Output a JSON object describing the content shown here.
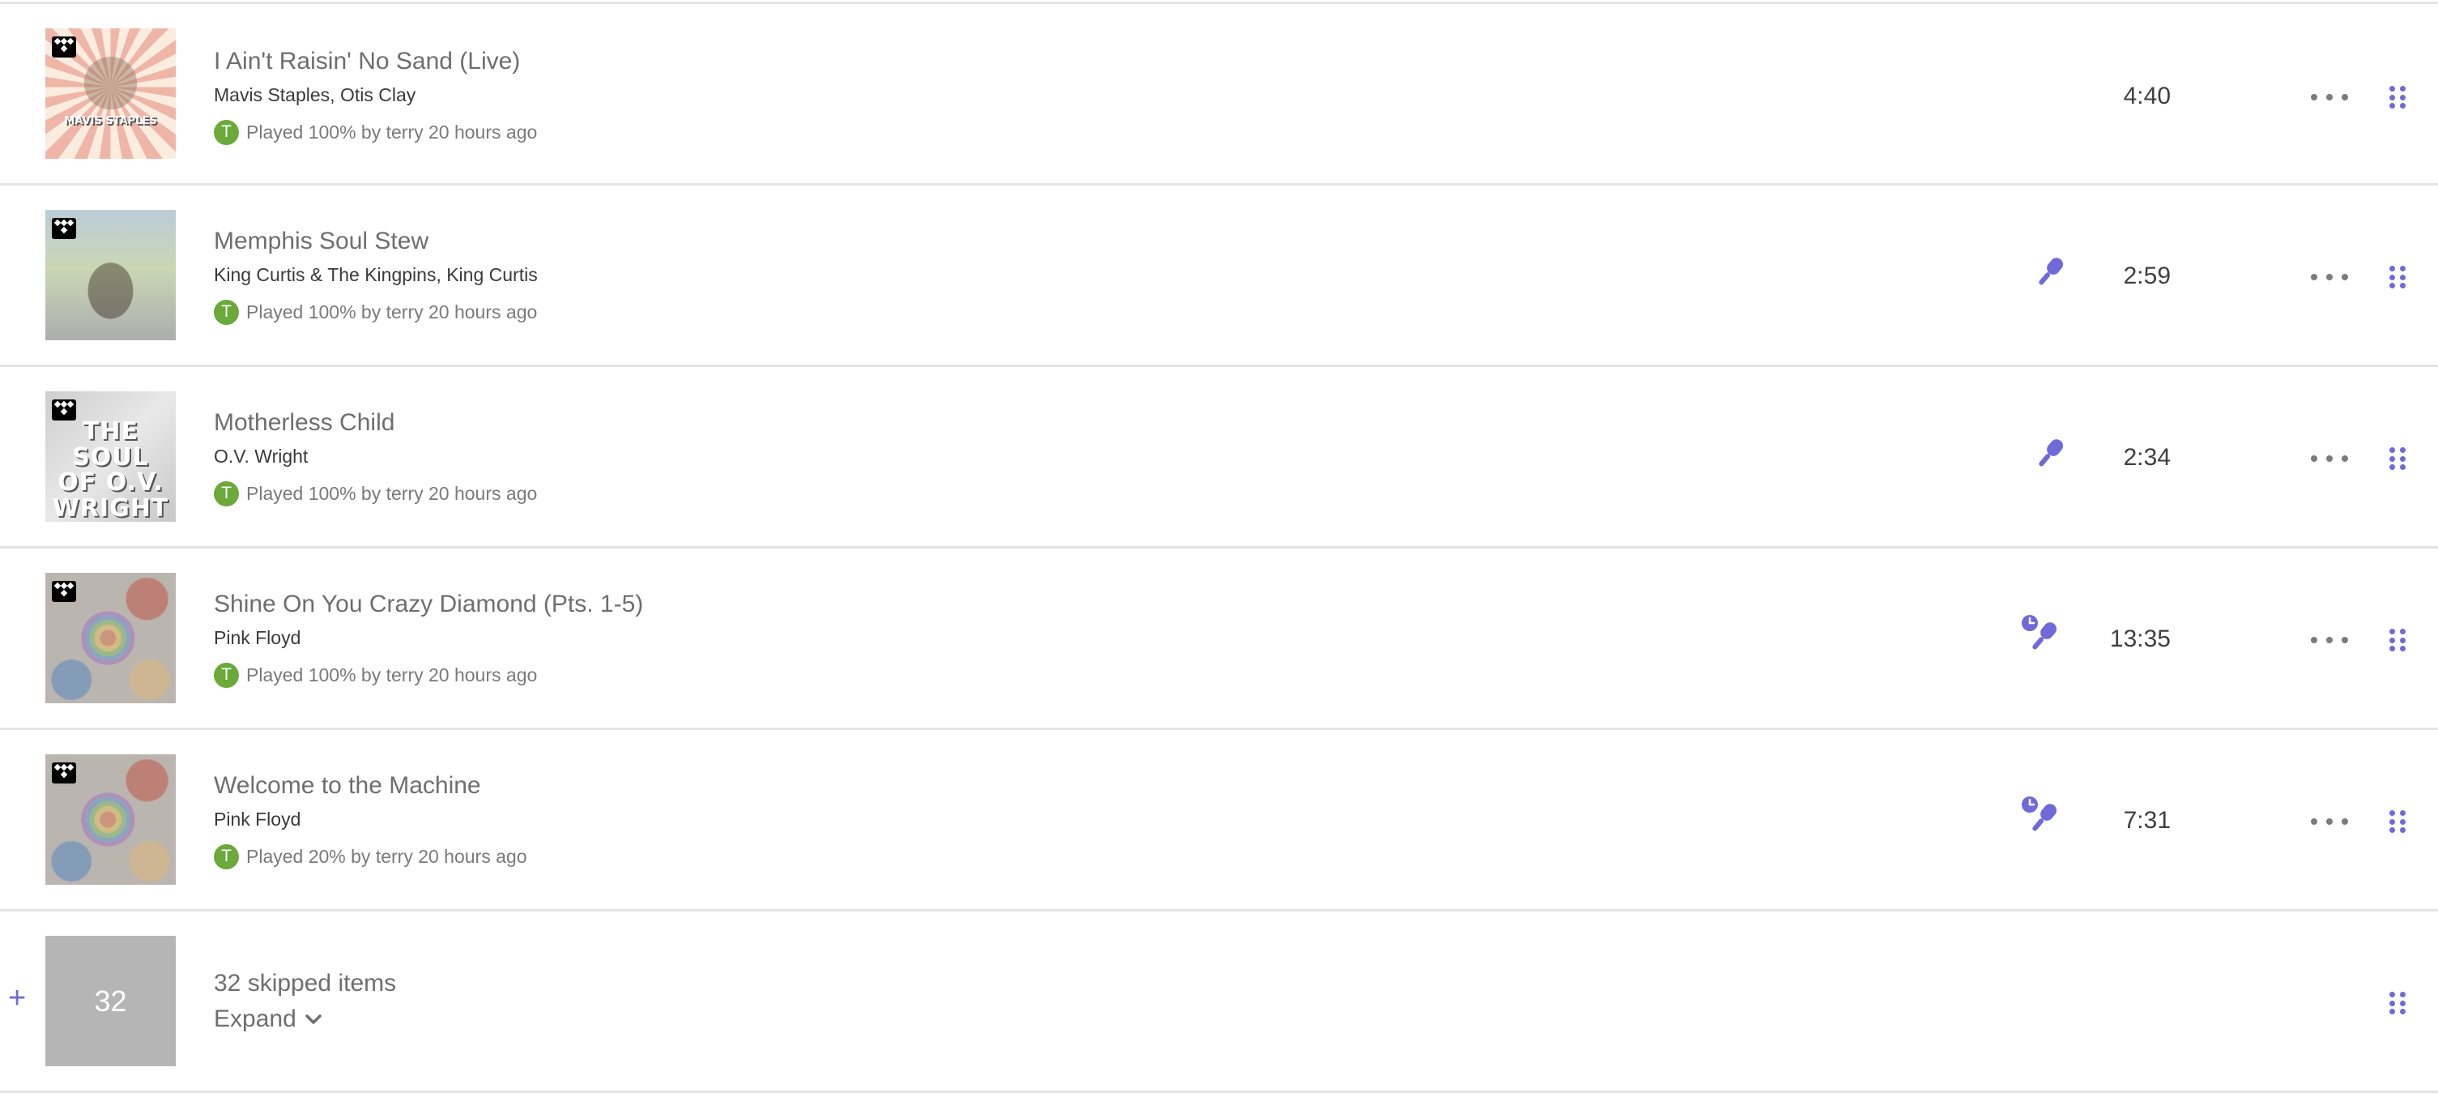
{
  "colors": {
    "accent": "#6f6ad8",
    "avatar": "#6aa93a",
    "divider": "#e4e4e4",
    "skipped_tile": "#b5b5b5"
  },
  "tracks": [
    {
      "title": "I Ain't Raisin' No Sand (Live)",
      "artists": "Mavis Staples, Otis Clay",
      "avatar_letter": "T",
      "played": "Played 100% by terry 20 hours ago",
      "duration": "4:40",
      "mic_icon": null,
      "art_text": "MAVIS STAPLES",
      "service_icon": "tidal-icon"
    },
    {
      "title": "Memphis Soul Stew",
      "artists": "King Curtis & The Kingpins, King Curtis",
      "avatar_letter": "T",
      "played": "Played 100% by terry 20 hours ago",
      "duration": "2:59",
      "mic_icon": "microphone-icon",
      "art_text": "",
      "service_icon": "tidal-icon"
    },
    {
      "title": "Motherless Child",
      "artists": "O.V. Wright",
      "avatar_letter": "T",
      "played": "Played 100% by terry 20 hours ago",
      "duration": "2:34",
      "mic_icon": "microphone-icon",
      "art_text": "THE SOUL OF O.V. WRIGHT",
      "service_icon": "tidal-icon"
    },
    {
      "title": "Shine On You Crazy Diamond (Pts. 1-5)",
      "artists": "Pink Floyd",
      "avatar_letter": "T",
      "played": "Played 100% by terry 20 hours ago",
      "duration": "13:35",
      "mic_icon": "timed-microphone-icon",
      "art_text": "",
      "service_icon": "tidal-icon"
    },
    {
      "title": "Welcome to the Machine",
      "artists": "Pink Floyd",
      "avatar_letter": "T",
      "played": "Played 20% by terry 20 hours ago",
      "duration": "7:31",
      "mic_icon": "timed-microphone-icon",
      "art_text": "",
      "service_icon": "tidal-icon"
    }
  ],
  "skipped": {
    "count": "32",
    "label": "32 skipped items",
    "expand_label": "Expand",
    "plus": "+"
  }
}
